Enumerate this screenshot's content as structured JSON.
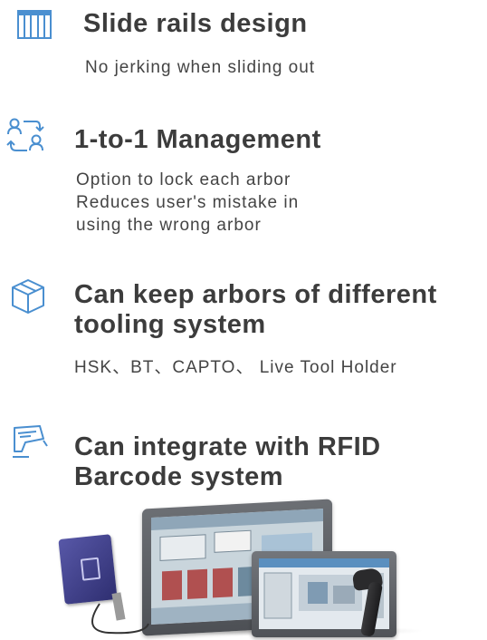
{
  "features": [
    {
      "icon": "slide-rails-icon",
      "title": "Slide rails design",
      "desc": [
        "No jerking when sliding out"
      ]
    },
    {
      "icon": "exchange-users-icon",
      "title": "1-to-1 Management",
      "desc": [
        "Option to lock each arbor",
        "Reduces user's mistake in",
        "using the wrong arbor"
      ]
    },
    {
      "icon": "box-icon",
      "title_lines": [
        "Can keep arbors of different",
        "tooling system"
      ],
      "desc": [
        "HSK、BT、CAPTO、 Live Tool Holder"
      ]
    },
    {
      "icon": "rfid-scanner-icon",
      "title_lines": [
        "Can integrate with RFID",
        "Barcode system"
      ]
    }
  ],
  "colors": {
    "icon_blue": "#4a8fd0",
    "title": "#3c3c3c",
    "text": "#444444"
  }
}
